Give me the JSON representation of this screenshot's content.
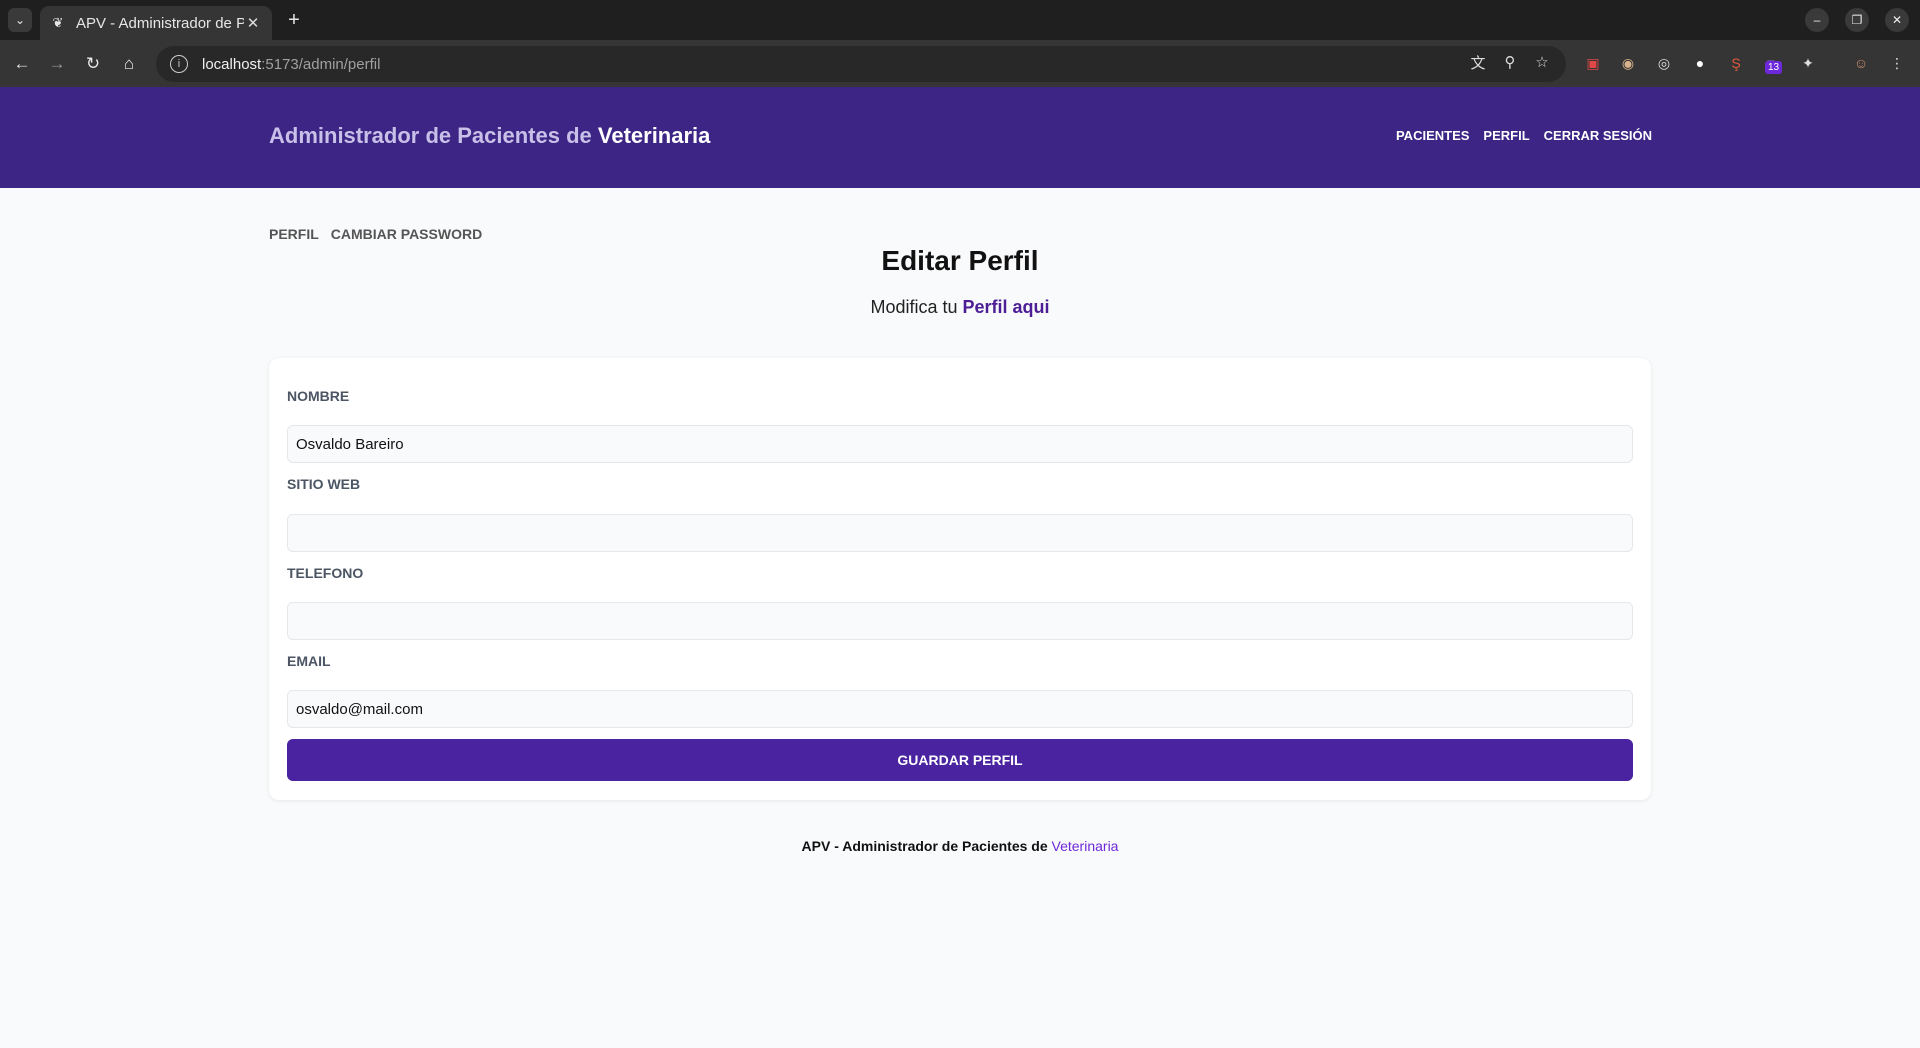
{
  "browser": {
    "tab_title": "APV - Administrador de Pacientes de Veterinaria",
    "url_host": "localhost",
    "url_path": ":5173/admin/perfil",
    "extension_badge": "13"
  },
  "header": {
    "brand_prefix": "Administrador de Pacientes de ",
    "brand_strong": "Veterinaria",
    "nav": {
      "pacientes": "Pacientes",
      "perfil": "Perfil",
      "cerrar_sesion": "Cerrar Sesión"
    }
  },
  "subnav": {
    "perfil": "PERFIL",
    "cambiar_password": "CAMBIAR PASSWORD"
  },
  "page": {
    "title": "Editar Perfil",
    "subtitle_prefix": "Modifica tu ",
    "subtitle_accent": "Perfil aqui"
  },
  "form": {
    "nombre_label": "Nombre",
    "nombre_value": "Osvaldo Bareiro",
    "web_label": "Sitio Web",
    "web_value": "",
    "telefono_label": "Telefono",
    "telefono_value": "",
    "email_label": "Email",
    "email_value": "osvaldo@mail.com",
    "save_label": "Guardar Perfil"
  },
  "footer": {
    "prefix": "APV - Administrador de Pacientes de ",
    "accent": "Veterinaria"
  },
  "colors": {
    "header_bg": "#3c2585",
    "button_bg": "#4a24a0",
    "accent": "#4c1d95"
  }
}
